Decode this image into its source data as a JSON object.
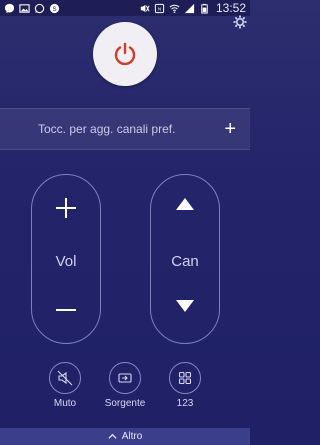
{
  "statusbar": {
    "time": "13:52",
    "left_icons": [
      "messenger-icon",
      "image-icon",
      "whatsapp-icon",
      "skype-icon"
    ],
    "right_icons": [
      "mute-icon",
      "nfc-icon",
      "wifi-icon",
      "signal-icon",
      "battery-icon"
    ]
  },
  "power": {
    "icon": "power-icon",
    "color": "#d23a2a"
  },
  "settings": {
    "icon": "gear-icon"
  },
  "favorites": {
    "text": "Tocc. per agg. canali pref.",
    "plus": "+"
  },
  "volume": {
    "label": "Vol",
    "up": "+",
    "down": "−"
  },
  "channel": {
    "label": "Can"
  },
  "buttons": [
    {
      "label": "Muto",
      "icon": "mute-speaker-icon"
    },
    {
      "label": "Sorgente",
      "icon": "source-input-icon"
    },
    {
      "label": "123",
      "icon": "number-grid-icon"
    }
  ],
  "more": {
    "label": "Altro",
    "icon": "chevron-up-icon"
  },
  "colors": {
    "background": "#23246a",
    "accent": "#3b3e8a"
  }
}
